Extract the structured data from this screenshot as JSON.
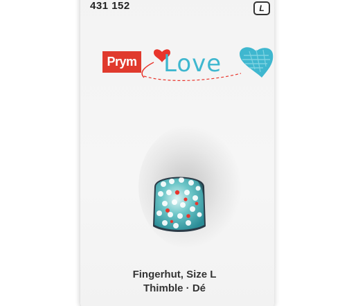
{
  "package": {
    "article_number": "431 152",
    "size_badge": "L",
    "brand": "Prym",
    "product_line": "Love",
    "product_name": "Fingerhut, Size L",
    "product_translations": "Thimble · Dé"
  },
  "colors": {
    "brand_red": "#e03a2d",
    "love_turquoise": "#3fb7cf",
    "heart_red": "#e8352c",
    "thimble_teal": "#3bb2b8"
  },
  "icons": [
    "red-heart-icon",
    "blue-heart-icon",
    "thimble-icon"
  ]
}
